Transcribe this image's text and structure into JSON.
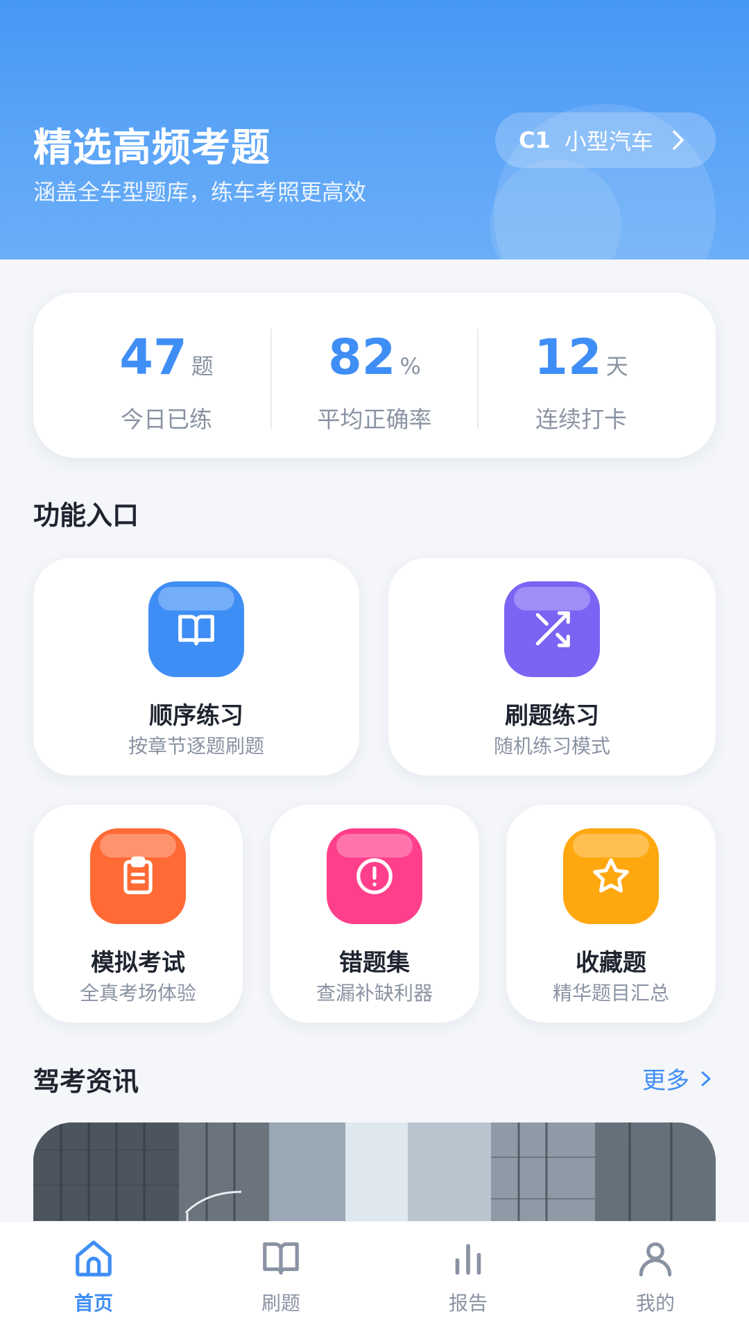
{
  "header": {
    "title": "精选高频考题",
    "subtitle": "涵盖全车型题库，练车考照更高效",
    "license_code": "C1",
    "license_name": "小型汽车"
  },
  "stats": [
    {
      "value": "47",
      "unit": "题",
      "label": "今日已练"
    },
    {
      "value": "82",
      "unit": "%",
      "label": "平均正确率"
    },
    {
      "value": "12",
      "unit": "天",
      "label": "连续打卡"
    }
  ],
  "features_title": "功能入口",
  "features": [
    {
      "title": "顺序练习",
      "subtitle": "按章节逐题刷题",
      "icon": "book-icon",
      "color": "#3f8ef5"
    },
    {
      "title": "刷题练习",
      "subtitle": "随机练习模式",
      "icon": "shuffle-icon",
      "color": "#7b63f3"
    },
    {
      "title": "模拟考试",
      "subtitle": "全真考场体验",
      "icon": "clipboard-icon",
      "color": "#ff6a35"
    },
    {
      "title": "错题集",
      "subtitle": "查漏补缺利器",
      "icon": "alert-icon",
      "color": "#ff3f8c"
    },
    {
      "title": "收藏题",
      "subtitle": "精华题目汇总",
      "icon": "star-icon",
      "color": "#ffa70f"
    }
  ],
  "news": {
    "title": "驾考资讯",
    "more_label": "更多"
  },
  "tabbar": [
    {
      "label": "首页",
      "icon": "home-icon"
    },
    {
      "label": "刷题",
      "icon": "book-icon"
    },
    {
      "label": "报告",
      "icon": "bar-chart-icon"
    },
    {
      "label": "我的",
      "icon": "user-icon"
    }
  ],
  "colors": {
    "primary": "#3f8ef5",
    "inactive": "#8a93a3"
  }
}
